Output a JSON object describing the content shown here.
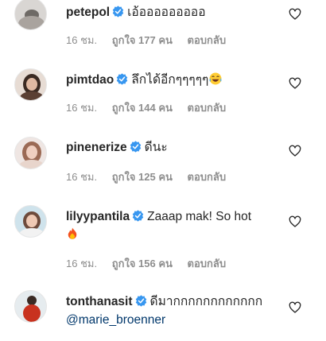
{
  "comments": [
    {
      "username": "petepol",
      "text": "เอ้อออออออออ",
      "time": "16 ชม.",
      "likes": "ถูกใจ 177 คน",
      "reply": "ตอบกลับ"
    },
    {
      "username": "pimtdao",
      "text": "ลึกได้อีกๆๆๆๆๆ",
      "emoji": "tears-of-joy",
      "time": "16 ชม.",
      "likes": "ถูกใจ 144 คน",
      "reply": "ตอบกลับ"
    },
    {
      "username": "pinenerize",
      "text": "ดีนะ",
      "time": "16 ชม.",
      "likes": "ถูกใจ 125 คน",
      "reply": "ตอบกลับ"
    },
    {
      "username": "lilyypantila",
      "text": "Zaaap mak! So hot",
      "emoji": "fire",
      "time": "16 ชม.",
      "likes": "ถูกใจ 156 คน",
      "reply": "ตอบกลับ"
    },
    {
      "username": "tonthanasit",
      "text": "ดีมากกกกกกกกกกกก",
      "mention": "@marie_broenner"
    }
  ],
  "icons": {
    "verified": "verified-badge-icon",
    "like": "heart-outline-icon"
  },
  "colors": {
    "verified": "#3897f0",
    "meta": "#8e8e8e",
    "mention": "#00376b"
  }
}
